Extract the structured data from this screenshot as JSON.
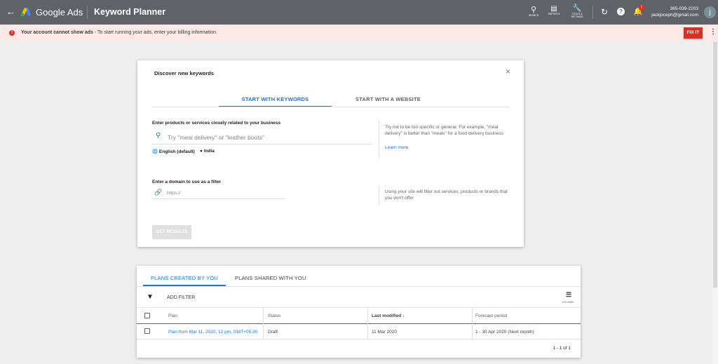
{
  "header": {
    "brand": "Google Ads",
    "page_title": "Keyword Planner",
    "tools": [
      {
        "icon": "search-icon",
        "label": "SEARCH"
      },
      {
        "icon": "reports-icon",
        "label": "REPORTS"
      },
      {
        "icon": "wrench-icon",
        "label": "TOOLS &",
        "label2": "SETTINGS"
      }
    ],
    "phone": "365-039-2203",
    "email": "jackjoceph@gmail.com",
    "avatar_letter": "j",
    "notification_badge": "!"
  },
  "banner": {
    "bold": "Your account cannot show ads",
    "text": " - To start running your ads, enter your billing information.",
    "fix_label": "FIX IT"
  },
  "modal": {
    "title": "Discover new keywords",
    "tabs": [
      "START WITH KEYWORDS",
      "START WITH A WEBSITE"
    ],
    "active_tab": 0,
    "keywords_label": "Enter products or services closely related to your business",
    "keywords_placeholder": "Try \"meal delivery\" or \"leather boots\"",
    "language": "English (default)",
    "location": "India",
    "hint1": "Try not to be too specific or general. For example, \"meal delivery\" is better than \"meals\" for a food delivery business",
    "learn_more": "Learn more",
    "domain_label": "Enter a domain to use as a filter",
    "domain_placeholder": "https://",
    "hint2": "Using your site will filter out services, products or brands that you don't offer",
    "get_results": "GET RESULTS"
  },
  "plans": {
    "tabs": [
      "PLANS CREATED BY YOU",
      "PLANS SHARED WITH YOU"
    ],
    "add_filter": "ADD FILTER",
    "columns_label": "COLUMNS",
    "headers": [
      "Plan",
      "Status",
      "Last modified",
      "Forecast period"
    ],
    "rows": [
      {
        "plan": "Plan from Mar 11, 2020, 12 pm, GMT+05:30",
        "status": "Draft",
        "modified": "11 Mar 2020",
        "forecast": "1 - 30 Apr 2020 (Next month)"
      }
    ],
    "pagination": "1 - 1 of 1"
  },
  "colors": {
    "accent": "#1a73e8",
    "danger": "#d93025",
    "header": "#5f6368"
  }
}
